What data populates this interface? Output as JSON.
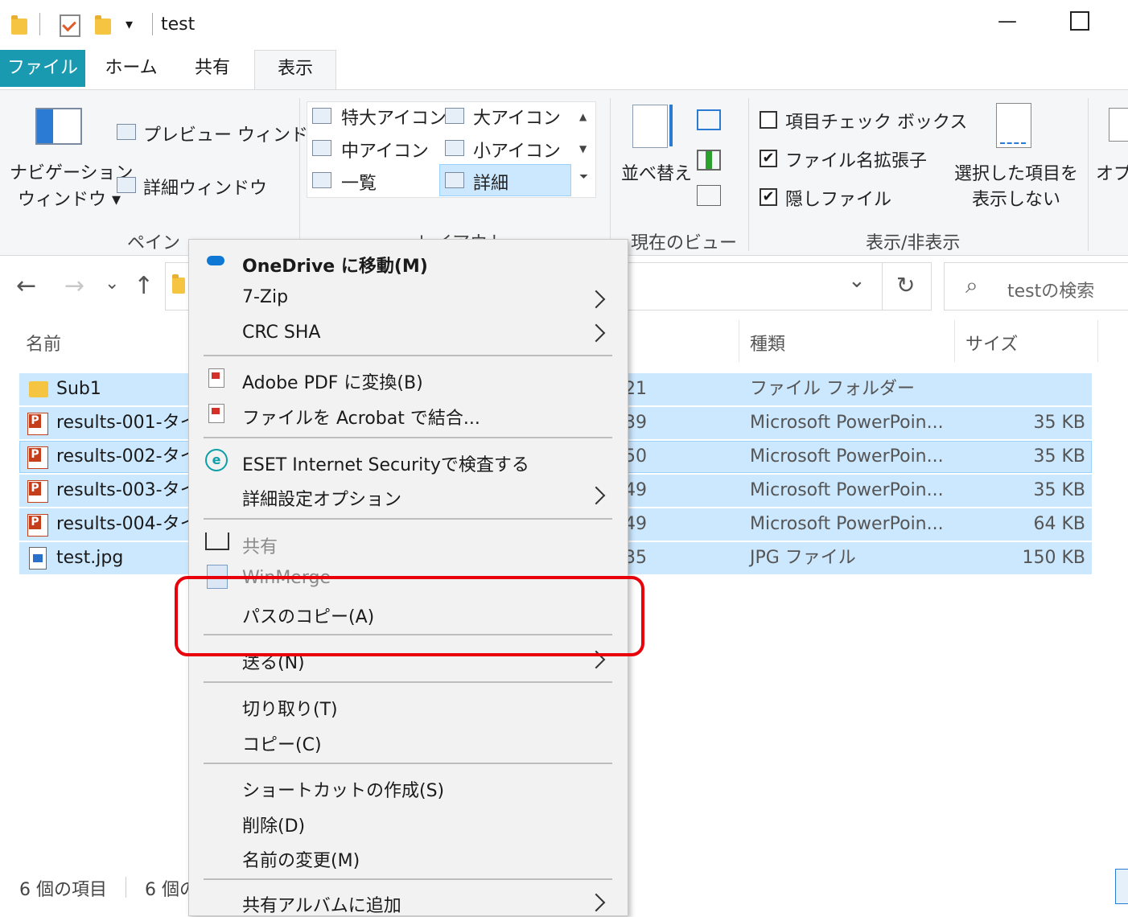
{
  "window": {
    "title": "test",
    "minimize_glyph": "—",
    "maximize_glyph": "☐"
  },
  "quick_access": {
    "dropdown_glyph": "▾"
  },
  "ribbon_tabs": {
    "file": "ファイル",
    "home": "ホーム",
    "share": "共有",
    "view": "表示"
  },
  "ribbon": {
    "pane": {
      "nav_pane_line1": "ナビゲーション",
      "nav_pane_line2": "ウィンドウ ▾",
      "preview_pane": "プレビュー ウィンドウ",
      "details_pane": "詳細ウィンドウ",
      "label": "ペイン"
    },
    "layout": {
      "extra_large": "特大アイコン",
      "large": "大アイコン",
      "medium": "中アイコン",
      "small": "小アイコン",
      "list": "一覧",
      "details": "詳細",
      "label": "レイアウト"
    },
    "current_view": {
      "sort": "並べ替え",
      "label": "現在のビュー"
    },
    "show_hide": {
      "item_checkbox": "項目チェック ボックス",
      "item_checkbox_checked": "",
      "file_ext": "ファイル名拡張子",
      "file_ext_checked": "✔",
      "hidden": "隠しファイル",
      "hidden_checked": "✔",
      "hide_selected_line1": "選択した項目を",
      "hide_selected_line2": "表示しない",
      "label": "表示/非表示"
    },
    "options": "オプ"
  },
  "nav": {
    "back": "←",
    "forward": "→",
    "recent": "⌄",
    "up": "↑",
    "dropdown": "⌄",
    "refresh": "↻",
    "search_icon": "⌕",
    "search_placeholder": "testの検索"
  },
  "columns": {
    "name": "名前",
    "type": "種類",
    "size": "サイズ"
  },
  "files": [
    {
      "name": "Sub1",
      "date_frag": "21",
      "type": "ファイル フォルダー",
      "size": ""
    },
    {
      "name": "results-001-タイ",
      "date_frag": "39",
      "type": "Microsoft PowerPoin...",
      "size": "35 KB"
    },
    {
      "name": "results-002-タイ",
      "date_frag": "50",
      "type": "Microsoft PowerPoin...",
      "size": "35 KB"
    },
    {
      "name": "results-003-タイ",
      "date_frag": "49",
      "type": "Microsoft PowerPoin...",
      "size": "35 KB"
    },
    {
      "name": "results-004-タイ",
      "date_frag": "49",
      "type": "Microsoft PowerPoin...",
      "size": "64 KB"
    },
    {
      "name": "test.jpg",
      "date_frag": "35",
      "type": "JPG ファイル",
      "size": "150 KB"
    }
  ],
  "status": {
    "count": "6 個の項目",
    "selected": "6 個の"
  },
  "context_menu": {
    "onedrive": "OneDrive に移動(M)",
    "zip": "7-Zip",
    "crc": "CRC SHA",
    "adobe_convert": "Adobe PDF に変換(B)",
    "acrobat_combine": "ファイルを Acrobat で結合...",
    "eset": "ESET Internet Securityで検査する",
    "eset_advanced": "詳細設定オプション",
    "share": "共有",
    "winmerge": "WinMerge",
    "copy_path": "パスのコピー(A)",
    "send_to": "送る(N)",
    "cut": "切り取り(T)",
    "copy": "コピー(C)",
    "shortcut": "ショートカットの作成(S)",
    "delete": "削除(D)",
    "rename": "名前の変更(M)",
    "album": "共有アルバムに追加"
  },
  "colors": {
    "file_tab": "#1a9ab0",
    "selection": "#cce8ff",
    "highlight_border": "#e8000b",
    "menu_bg": "#f2f2f2"
  }
}
